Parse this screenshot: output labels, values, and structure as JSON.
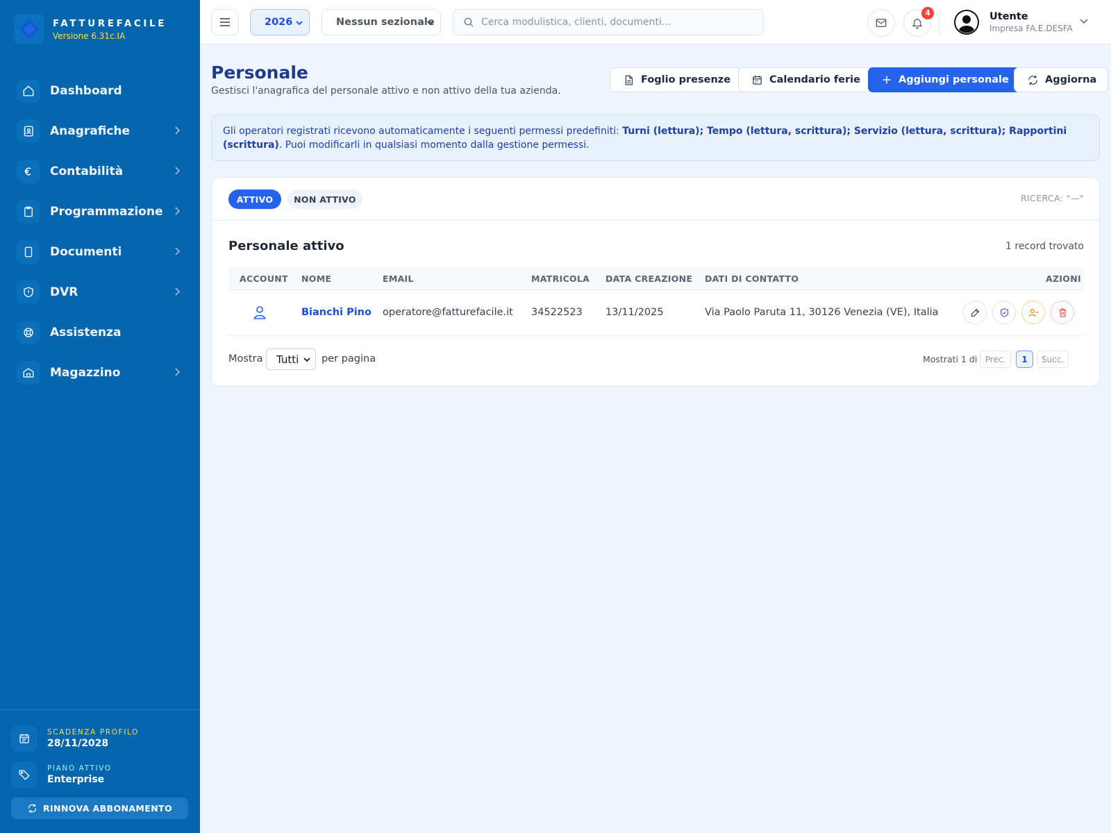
{
  "brand": {
    "name": "FATTUREFACILE",
    "version": "Versione 6.31c.IA"
  },
  "sidebar": {
    "items": [
      {
        "label": "Dashboard",
        "icon": "home-icon",
        "chevron": false
      },
      {
        "label": "Anagrafiche",
        "icon": "contacts-icon",
        "chevron": true
      },
      {
        "label": "Contabilità",
        "icon": "euro-icon",
        "chevron": true
      },
      {
        "label": "Programmazione",
        "icon": "clipboard-icon",
        "chevron": true
      },
      {
        "label": "Documenti",
        "icon": "document-icon",
        "chevron": true
      },
      {
        "label": "DVR",
        "icon": "shield-alert-icon",
        "chevron": true
      },
      {
        "label": "Assistenza",
        "icon": "lifebuoy-icon",
        "chevron": false
      },
      {
        "label": "Magazzino",
        "icon": "warehouse-icon",
        "chevron": true
      }
    ],
    "expiry": {
      "label": "SCADENZA PROFILO",
      "value": "28/11/2028"
    },
    "plan": {
      "label": "PIANO ATTIVO",
      "value": "Enterprise"
    },
    "renew_label": "RINNOVA ABBONAMENTO"
  },
  "topbar": {
    "year": "2026",
    "sezionale": "Nessun sezionale",
    "search_placeholder": "Cerca modulistica, clienti, documenti...",
    "notifications_count": "4",
    "user_name": "Utente",
    "user_company": "Impresa FA.E.DESFA"
  },
  "header": {
    "title": "Personale",
    "subtitle": "Gestisci l'anagrafica del personale attivo e non attivo della tua azienda.",
    "buttons": {
      "foglio": "Foglio presenze",
      "calendario": "Calendario ferie",
      "aggiungi": "Aggiungi personale",
      "aggiorna": "Aggiorna"
    }
  },
  "info": {
    "prefix": "Gli operatori registrati ricevono automaticamente i seguenti permessi predefiniti: ",
    "permissions": "Turni (lettura); Tempo (lettura, scrittura); Servizio (lettura, scrittura); Rapportini (scrittura)",
    "suffix": ". Puoi modificarli in qualsiasi momento dalla gestione permessi."
  },
  "card": {
    "tab_active": "ATTIVO",
    "tab_inactive": "NON ATTIVO",
    "search_tag": "RICERCA: \"—\"",
    "section_title": "Personale attivo",
    "record_count": "1 record trovato",
    "columns": {
      "account": "ACCOUNT",
      "nome": "NOME",
      "email": "EMAIL",
      "matricola": "MATRICOLA",
      "data": "DATA CREAZIONE",
      "contatto": "DATI DI CONTATTO",
      "azioni": "AZIONI"
    },
    "rows": [
      {
        "nome": "Bianchi Pino",
        "email": "operatore@fatturefacile.it",
        "matricola": "34522523",
        "data": "13/11/2025",
        "contatto": "Via Paolo Paruta 11, 30126 Venezia (VE), Italia"
      }
    ],
    "footer": {
      "mostra": "Mostra",
      "per_page": "Tutti",
      "per_pagina": "per pagina",
      "mostrati": "Mostrati 1 di 1",
      "prev": "Prec.",
      "page": "1",
      "next": "Succ."
    }
  },
  "colors": {
    "sidebar": "#0565ad",
    "primary": "#2563eb",
    "title": "#1e3a8a",
    "badge": "#ef4444",
    "accent_yellow": "#fde047"
  }
}
